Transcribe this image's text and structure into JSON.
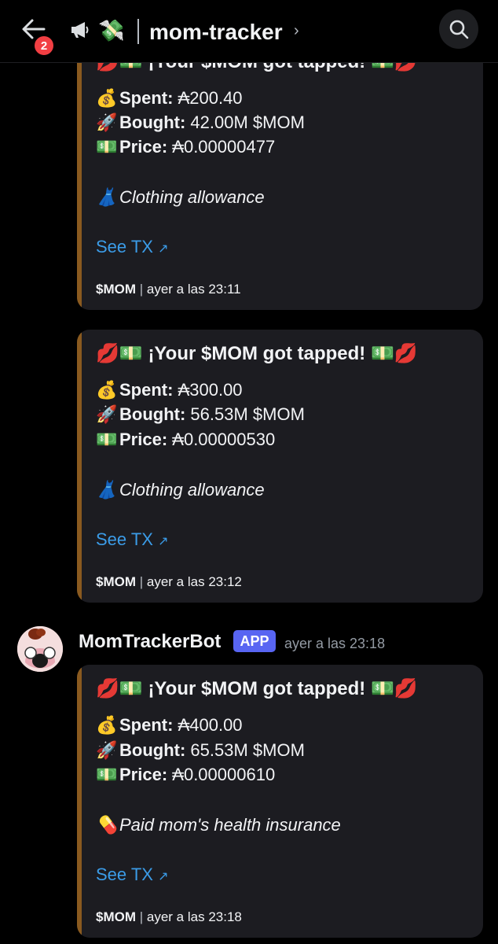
{
  "header": {
    "unread_count": "2",
    "channel_name": "mom-tracker",
    "chevron": "›",
    "icons": [
      "back-arrow-icon",
      "megaphone-icon",
      "money-with-wings-icon",
      "search-icon"
    ]
  },
  "author": {
    "name": "MomTrackerBot",
    "tag": "APP",
    "timestamp": "ayer a las 23:18"
  },
  "embeds": [
    {
      "title_emoji_left": "💋💵",
      "title": "¡Your $MOM got tapped!",
      "title_emoji_right": "💵💋",
      "spent_emoji": "💰",
      "spent_label": "Spent:",
      "spent_value": "₳200.40",
      "bought_emoji": "🚀",
      "bought_label": "Bought:",
      "bought_value": "42.00M $MOM",
      "price_emoji": "💵",
      "price_label": "Price:",
      "price_value": "₳0.00000477",
      "note_emoji": "👗",
      "note": "Clothing allowance",
      "link": "See TX",
      "link_icon": "↗",
      "footer_ticker": "$MOM",
      "footer_sep": "|",
      "footer_time": "ayer a las 23:11"
    },
    {
      "title_emoji_left": "💋💵",
      "title": "¡Your $MOM got tapped!",
      "title_emoji_right": "💵💋",
      "spent_emoji": "💰",
      "spent_label": "Spent:",
      "spent_value": "₳300.00",
      "bought_emoji": "🚀",
      "bought_label": "Bought:",
      "bought_value": "56.53M $MOM",
      "price_emoji": "💵",
      "price_label": "Price:",
      "price_value": "₳0.00000530",
      "note_emoji": "👗",
      "note": "Clothing allowance",
      "link": "See TX",
      "link_icon": "↗",
      "footer_ticker": "$MOM",
      "footer_sep": "|",
      "footer_time": "ayer a las 23:12"
    },
    {
      "title_emoji_left": "💋💵",
      "title": "¡Your $MOM got tapped!",
      "title_emoji_right": "💵💋",
      "spent_emoji": "💰",
      "spent_label": "Spent:",
      "spent_value": "₳400.00",
      "bought_emoji": "🚀",
      "bought_label": "Bought:",
      "bought_value": "65.53M $MOM",
      "price_emoji": "💵",
      "price_label": "Price:",
      "price_value": "₳0.00000610",
      "note_emoji": "💊",
      "note": "Paid mom's health insurance",
      "link": "See TX",
      "link_icon": "↗",
      "footer_ticker": "$MOM",
      "footer_sep": "|",
      "footer_time": "ayer a las 23:18"
    }
  ],
  "colors": {
    "background": "#000000",
    "embed_bg": "#1c1c21",
    "embed_border": "#8a5a1f",
    "link": "#3b9ce8",
    "app_tag": "#5865f2",
    "badge": "#f23f43"
  }
}
